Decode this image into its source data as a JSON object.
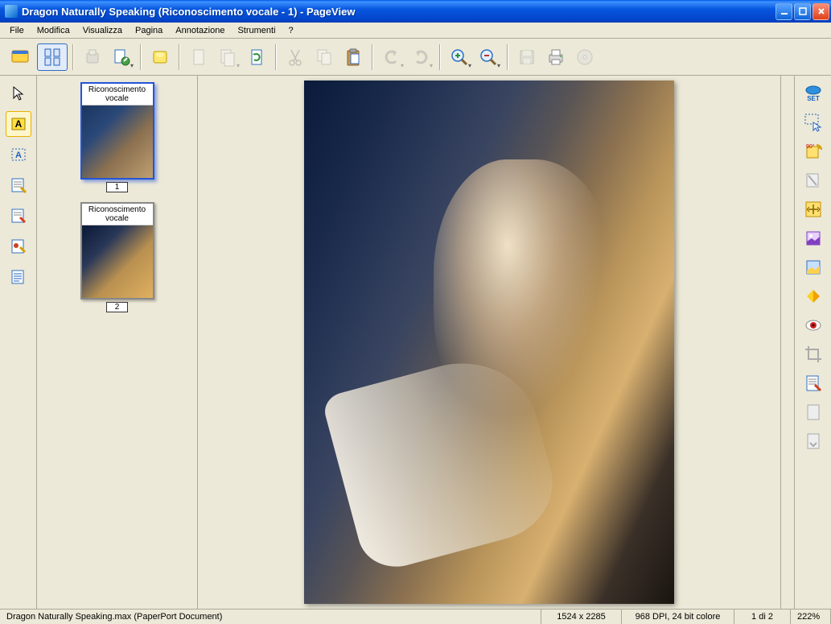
{
  "window": {
    "title": "Dragon Naturally Speaking (Riconoscimento vocale - 1) - PageView"
  },
  "menu": {
    "items": [
      "File",
      "Modifica",
      "Visualizza",
      "Pagina",
      "Annotazione",
      "Strumenti",
      "?"
    ]
  },
  "thumbnails": {
    "page1": {
      "title": "Riconoscimento vocale",
      "num": "1"
    },
    "page2": {
      "title": "Riconoscimento vocale",
      "num": "2"
    }
  },
  "statusbar": {
    "filename": "Dragon Naturally Speaking.max (PaperPort Document)",
    "dimensions": "1524 x 2285",
    "dpi_color": "968 DPI, 24 bit colore",
    "page": "1 di 2",
    "zoom": "222%"
  }
}
